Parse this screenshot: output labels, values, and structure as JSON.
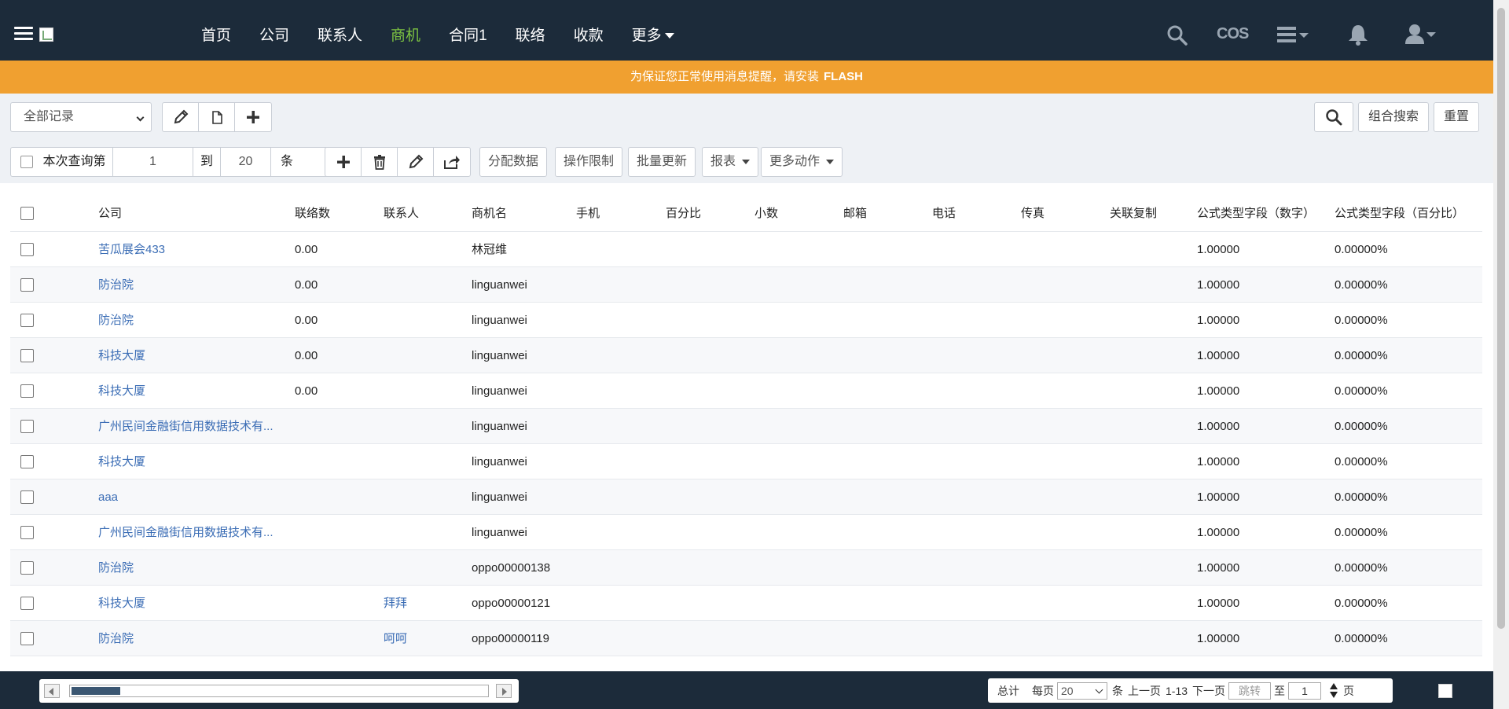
{
  "nav": {
    "items": [
      {
        "label": "首页",
        "active": false
      },
      {
        "label": "公司",
        "active": false
      },
      {
        "label": "联系人",
        "active": false
      },
      {
        "label": "商机",
        "active": true
      },
      {
        "label": "合同1",
        "active": false
      },
      {
        "label": "联络",
        "active": false
      },
      {
        "label": "收款",
        "active": false
      },
      {
        "label": "更多",
        "active": false,
        "dropdown": true
      }
    ],
    "cos_label": "COS",
    "icons": [
      "search-icon",
      "list-menu-icon",
      "bell-icon",
      "user-icon"
    ],
    "active_color": "#7cc241"
  },
  "banner": {
    "text": "为保证您正常使用消息提醒，请安装",
    "emphasis": "FLASH",
    "color": "#f0a030"
  },
  "toolbar": {
    "view_select": "全部记录",
    "search_combined": "组合搜索",
    "reset": "重置"
  },
  "query": {
    "prefix": "本次查询第",
    "from": "1",
    "to_label": "到",
    "to": "20",
    "unit": "条"
  },
  "actions": {
    "assign": "分配数据",
    "op_limit": "操作限制",
    "batch_update": "批量更新",
    "report": "报表",
    "more": "更多动作"
  },
  "table": {
    "columns": [
      "公司",
      "联络数",
      "联系人",
      "商机名",
      "手机",
      "百分比",
      "小数",
      "邮箱",
      "电话",
      "传真",
      "关联复制",
      "公式类型字段（数字）",
      "公式类型字段（百分比）"
    ],
    "rows": [
      {
        "company": "苦瓜展会433",
        "contact_count": "0.00",
        "contact": "",
        "name": "林冠维",
        "num": "1.00000",
        "pct": "0.00000%"
      },
      {
        "company": "防治院",
        "contact_count": "0.00",
        "contact": "",
        "name": "linguanwei",
        "num": "1.00000",
        "pct": "0.00000%"
      },
      {
        "company": "防治院",
        "contact_count": "0.00",
        "contact": "",
        "name": "linguanwei",
        "num": "1.00000",
        "pct": "0.00000%"
      },
      {
        "company": "科技大厦",
        "contact_count": "0.00",
        "contact": "",
        "name": "linguanwei",
        "num": "1.00000",
        "pct": "0.00000%"
      },
      {
        "company": "科技大厦",
        "contact_count": "0.00",
        "contact": "",
        "name": "linguanwei",
        "num": "1.00000",
        "pct": "0.00000%"
      },
      {
        "company": "广州民间金融街信用数据技术有...",
        "contact_count": "",
        "contact": "",
        "name": "linguanwei",
        "num": "1.00000",
        "pct": "0.00000%"
      },
      {
        "company": "科技大厦",
        "contact_count": "",
        "contact": "",
        "name": "linguanwei",
        "num": "1.00000",
        "pct": "0.00000%"
      },
      {
        "company": "aaa",
        "contact_count": "",
        "contact": "",
        "name": "linguanwei",
        "num": "1.00000",
        "pct": "0.00000%"
      },
      {
        "company": "广州民间金融街信用数据技术有...",
        "contact_count": "",
        "contact": "",
        "name": "linguanwei",
        "num": "1.00000",
        "pct": "0.00000%"
      },
      {
        "company": "防治院",
        "contact_count": "",
        "contact": "",
        "name": "oppo00000138",
        "num": "1.00000",
        "pct": "0.00000%"
      },
      {
        "company": "科技大厦",
        "contact_count": "",
        "contact": "拜拜",
        "name": "oppo00000121",
        "num": "1.00000",
        "pct": "0.00000%"
      },
      {
        "company": "防治院",
        "contact_count": "",
        "contact": "呵呵",
        "name": "oppo00000119",
        "num": "1.00000",
        "pct": "0.00000%"
      }
    ]
  },
  "pagination": {
    "total_label": "总计",
    "per_page_label": "每页",
    "per_page": "20",
    "unit": "条",
    "prev": "上一页",
    "range": "1-13",
    "next": "下一页",
    "jump_placeholder": "跳转",
    "to_label": "至",
    "page": "1",
    "page_label": "页"
  }
}
